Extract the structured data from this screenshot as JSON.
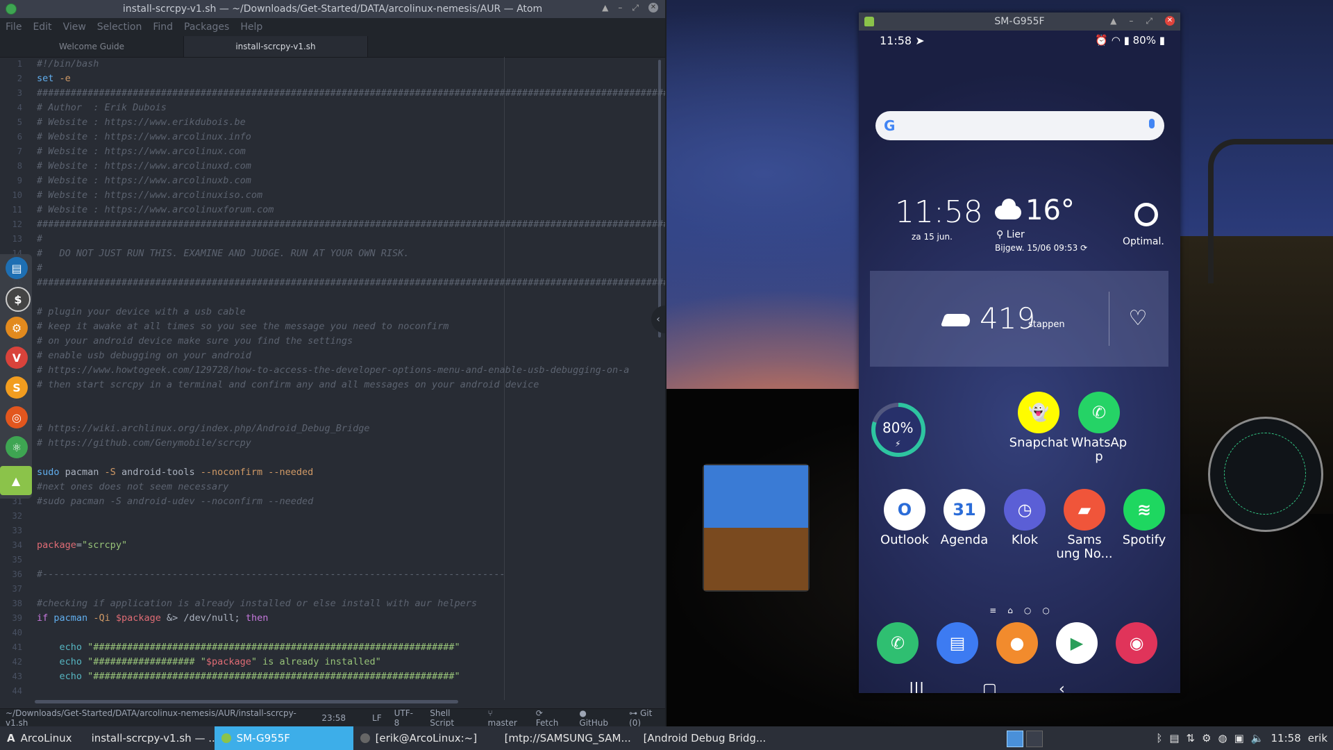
{
  "atom": {
    "title": "install-scrcpy-v1.sh — ~/Downloads/Get-Started/DATA/arcolinux-nemesis/AUR — Atom",
    "menu": [
      "File",
      "Edit",
      "View",
      "Selection",
      "Find",
      "Packages",
      "Help"
    ],
    "tabs": [
      "Welcome Guide",
      "install-scrcpy-v1.sh"
    ],
    "status": {
      "path": "~/Downloads/Get-Started/DATA/arcolinux-nemesis/AUR/install-scrcpy-v1.sh",
      "cursor": "23:58",
      "eol": "LF",
      "encoding": "UTF-8",
      "grammar": "Shell Script",
      "branch": "master",
      "fetch": "Fetch",
      "github": "GitHub",
      "git": "Git (0)"
    },
    "lines": [
      {
        "n": "1",
        "parts": [
          {
            "c": "c",
            "t": "#!/bin/bash"
          }
        ]
      },
      {
        "n": "2",
        "parts": [
          {
            "c": "f",
            "t": "set"
          },
          {
            "c": "o",
            "t": " -e"
          }
        ]
      },
      {
        "n": "3",
        "parts": [
          {
            "c": "c",
            "t": "##################################################################################################################"
          }
        ]
      },
      {
        "n": "4",
        "parts": [
          {
            "c": "c",
            "t": "# Author  : Erik Dubois"
          }
        ]
      },
      {
        "n": "5",
        "parts": [
          {
            "c": "c",
            "t": "# Website : https://www.erikdubois.be"
          }
        ]
      },
      {
        "n": "6",
        "parts": [
          {
            "c": "c",
            "t": "# Website : https://www.arcolinux.info"
          }
        ]
      },
      {
        "n": "7",
        "parts": [
          {
            "c": "c",
            "t": "# Website : https://www.arcolinux.com"
          }
        ]
      },
      {
        "n": "8",
        "parts": [
          {
            "c": "c",
            "t": "# Website : https://www.arcolinuxd.com"
          }
        ]
      },
      {
        "n": "9",
        "parts": [
          {
            "c": "c",
            "t": "# Website : https://www.arcolinuxb.com"
          }
        ]
      },
      {
        "n": "10",
        "parts": [
          {
            "c": "c",
            "t": "# Website : https://www.arcolinuxiso.com"
          }
        ]
      },
      {
        "n": "11",
        "parts": [
          {
            "c": "c",
            "t": "# Website : https://www.arcolinuxforum.com"
          }
        ]
      },
      {
        "n": "12",
        "parts": [
          {
            "c": "c",
            "t": "##################################################################################################################"
          }
        ]
      },
      {
        "n": "13",
        "parts": [
          {
            "c": "c",
            "t": "#"
          }
        ]
      },
      {
        "n": "14",
        "parts": [
          {
            "c": "c",
            "t": "#   DO NOT JUST RUN THIS. EXAMINE AND JUDGE. RUN AT YOUR OWN RISK."
          }
        ]
      },
      {
        "n": "15",
        "parts": [
          {
            "c": "c",
            "t": "#"
          }
        ]
      },
      {
        "n": "16",
        "parts": [
          {
            "c": "c",
            "t": "##################################################################################################################"
          }
        ]
      },
      {
        "n": "17",
        "parts": []
      },
      {
        "n": "18",
        "parts": [
          {
            "c": "c",
            "t": "# plugin your device with a usb cable"
          }
        ]
      },
      {
        "n": "19",
        "parts": [
          {
            "c": "c",
            "t": "# keep it awake at all times so you see the message you need to noconfirm"
          }
        ]
      },
      {
        "n": "20",
        "parts": [
          {
            "c": "c",
            "t": "# on your android device make sure you find the settings"
          }
        ]
      },
      {
        "n": "21",
        "parts": [
          {
            "c": "c",
            "t": "# enable usb debugging on your android"
          }
        ]
      },
      {
        "n": "22",
        "parts": [
          {
            "c": "c",
            "t": "# https://www.howtogeek.com/129728/how-to-access-the-developer-options-menu-and-enable-usb-debugging-on-a"
          }
        ]
      },
      {
        "n": "23",
        "parts": [
          {
            "c": "c",
            "t": "# then start scrcpy in a terminal and confirm any and all messages on your android device"
          }
        ]
      },
      {
        "n": "24",
        "parts": []
      },
      {
        "n": "25",
        "parts": []
      },
      {
        "n": "26",
        "parts": [
          {
            "c": "c",
            "t": "# https://wiki.archlinux.org/index.php/Android_Debug_Bridge"
          }
        ]
      },
      {
        "n": "27",
        "parts": [
          {
            "c": "c",
            "t": "# https://github.com/Genymobile/scrcpy"
          }
        ]
      },
      {
        "n": "28",
        "parts": []
      },
      {
        "n": "29",
        "parts": [
          {
            "c": "f",
            "t": "sudo"
          },
          {
            "c": "t",
            "t": " pacman "
          },
          {
            "c": "o",
            "t": "-S"
          },
          {
            "c": "t",
            "t": " android-tools "
          },
          {
            "c": "o",
            "t": "--noconfirm --needed"
          }
        ]
      },
      {
        "n": "30",
        "parts": [
          {
            "c": "c",
            "t": "#next ones does not seem necessary"
          }
        ]
      },
      {
        "n": "31",
        "parts": [
          {
            "c": "c",
            "t": "#sudo pacman -S android-udev --noconfirm --needed"
          }
        ]
      },
      {
        "n": "32",
        "parts": []
      },
      {
        "n": "33",
        "parts": []
      },
      {
        "n": "34",
        "parts": [
          {
            "c": "v",
            "t": "package"
          },
          {
            "c": "t",
            "t": "="
          },
          {
            "c": "s",
            "t": "\"scrcpy\""
          }
        ]
      },
      {
        "n": "35",
        "parts": []
      },
      {
        "n": "36",
        "parts": [
          {
            "c": "c",
            "t": "#----------------------------------------------------------------------------------"
          }
        ]
      },
      {
        "n": "37",
        "parts": []
      },
      {
        "n": "38",
        "parts": [
          {
            "c": "c",
            "t": "#checking if application is already installed or else install with aur helpers"
          }
        ]
      },
      {
        "n": "39",
        "parts": [
          {
            "c": "k",
            "t": "if"
          },
          {
            "c": "t",
            "t": " "
          },
          {
            "c": "f",
            "t": "pacman"
          },
          {
            "c": "t",
            "t": " "
          },
          {
            "c": "o",
            "t": "-Qi"
          },
          {
            "c": "t",
            "t": " "
          },
          {
            "c": "v",
            "t": "$package"
          },
          {
            "c": "t",
            "t": " &> /dev/null; "
          },
          {
            "c": "k",
            "t": "then"
          }
        ]
      },
      {
        "n": "40",
        "parts": []
      },
      {
        "n": "41",
        "parts": [
          {
            "c": "t",
            "t": "    "
          },
          {
            "c": "cyan",
            "t": "echo"
          },
          {
            "c": "s",
            "t": " \"################################################################\""
          }
        ]
      },
      {
        "n": "42",
        "parts": [
          {
            "c": "t",
            "t": "    "
          },
          {
            "c": "cyan",
            "t": "echo"
          },
          {
            "c": "s",
            "t": " \"################## \""
          },
          {
            "c": "v",
            "t": "$package"
          },
          {
            "c": "s",
            "t": "\" is already installed\""
          }
        ]
      },
      {
        "n": "43",
        "parts": [
          {
            "c": "t",
            "t": "    "
          },
          {
            "c": "cyan",
            "t": "echo"
          },
          {
            "c": "s",
            "t": " \"################################################################\""
          }
        ]
      },
      {
        "n": "44",
        "parts": []
      }
    ]
  },
  "phone": {
    "window_title": "SM-G955F",
    "status_time": "11:58",
    "status_battery": "80%",
    "clock_time": "11:58",
    "clock_date": "za 15 jun.",
    "weather_temp": "16°",
    "weather_location": "Lier",
    "weather_updated": "Bijgew. 15/06 09:53",
    "optimal_label": "Optimal.",
    "steps_count": "419",
    "steps_label": "stappen",
    "battery_widget": "80%",
    "apps_row1": [
      {
        "label": "Snapchat",
        "color": "#fffc00",
        "glyph": "👻"
      },
      {
        "label": "WhatsAp\np",
        "color": "#25d366",
        "glyph": "✆"
      }
    ],
    "apps_row2": [
      {
        "label": "Outlook",
        "color": "#ffffff",
        "glyph": "O"
      },
      {
        "label": "Agenda",
        "color": "#ffffff",
        "glyph": "31"
      },
      {
        "label": "Klok",
        "color": "#5b5fd6",
        "glyph": "◷"
      },
      {
        "label": "Sams\nung No...",
        "color": "#f0553a",
        "glyph": "▰"
      },
      {
        "label": "Spotify",
        "color": "#1ed760",
        "glyph": "≋"
      }
    ],
    "dock": [
      {
        "name": "phone",
        "color": "#2fbf71",
        "glyph": "✆"
      },
      {
        "name": "messages",
        "color": "#3d7bf2",
        "glyph": "▤"
      },
      {
        "name": "contacts",
        "color": "#f28b2d",
        "glyph": "●"
      },
      {
        "name": "play-store",
        "color": "#ffffff",
        "glyph": "▶"
      },
      {
        "name": "camera",
        "color": "#e0345a",
        "glyph": "◉"
      }
    ]
  },
  "taskbar": {
    "start": "ArcoLinux",
    "items": [
      {
        "label": "install-scrcpy-v1.sh — ...",
        "color": "#3ea552",
        "active": false
      },
      {
        "label": "SM-G955F",
        "color": "#8bc34a",
        "active": true
      },
      {
        "label": "[erik@ArcoLinux:~]",
        "color": "#666",
        "active": false
      },
      {
        "label": "[mtp://SAMSUNG_SAM...",
        "color": "#5a8ad0",
        "active": false
      },
      {
        "label": "[Android Debug Bridg...",
        "color": "#d9433b",
        "active": false
      }
    ],
    "clock": "11:58",
    "user": "erik"
  }
}
